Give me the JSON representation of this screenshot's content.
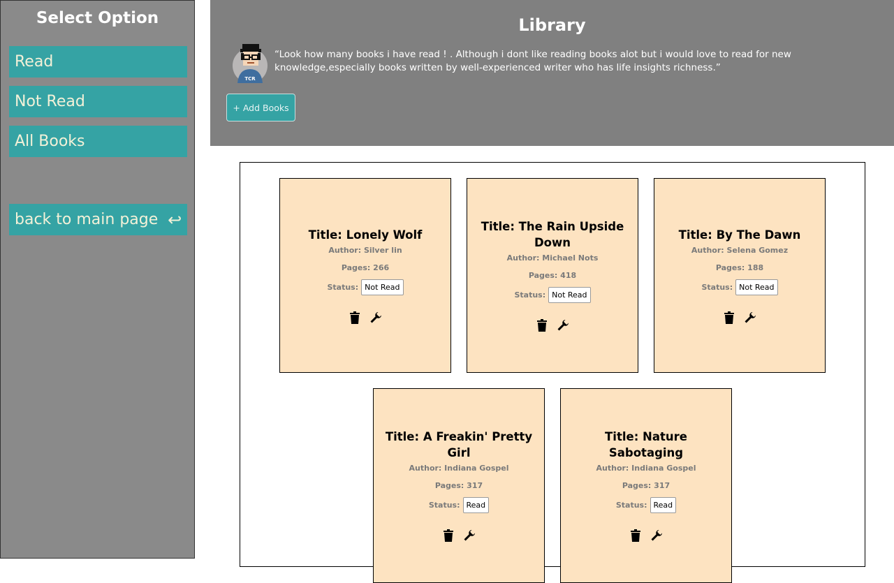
{
  "sidebar": {
    "title": "Select Option",
    "items": [
      {
        "label": "Read"
      },
      {
        "label": "Not Read"
      },
      {
        "label": "All Books"
      }
    ],
    "back_label": "back to main page",
    "back_icon": "↩"
  },
  "header": {
    "title": "Library",
    "avatar_label": "TCR",
    "quote": "“Look how many books i have read ! . Although i dont like reading books alot but i would love to read for new knowledge,especially books written by well-experienced writer who has life insights richness.”",
    "add_button": "+ Add Books"
  },
  "books": [
    {
      "title": "Title: Lonely Wolf",
      "author": "Author: Silver lin",
      "pages": "Pages: 266",
      "status_label": "Status:",
      "status": "Not Read"
    },
    {
      "title": "Title: The Rain Upside Down",
      "author": "Author: Michael Nots",
      "pages": "Pages: 418",
      "status_label": "Status:",
      "status": "Not Read"
    },
    {
      "title": "Title: By The Dawn",
      "author": "Author: Selena Gomez",
      "pages": "Pages: 188",
      "status_label": "Status:",
      "status": "Not Read"
    },
    {
      "title": "Title: A Freakin' Pretty Girl",
      "author": "Author: Indiana Gospel",
      "pages": "Pages: 317",
      "status_label": "Status:",
      "status": "Read"
    },
    {
      "title": "Title: Nature Sabotaging",
      "author": "Author: Indiana Gospel",
      "pages": "Pages: 317",
      "status_label": "Status:",
      "status": "Read"
    }
  ],
  "icons": {
    "delete": "trash-icon",
    "edit": "wrench-icon"
  },
  "colors": {
    "accent": "#35a3a4",
    "card": "#fde3c1",
    "sidebar": "#8a8a8a",
    "header": "#808080"
  }
}
